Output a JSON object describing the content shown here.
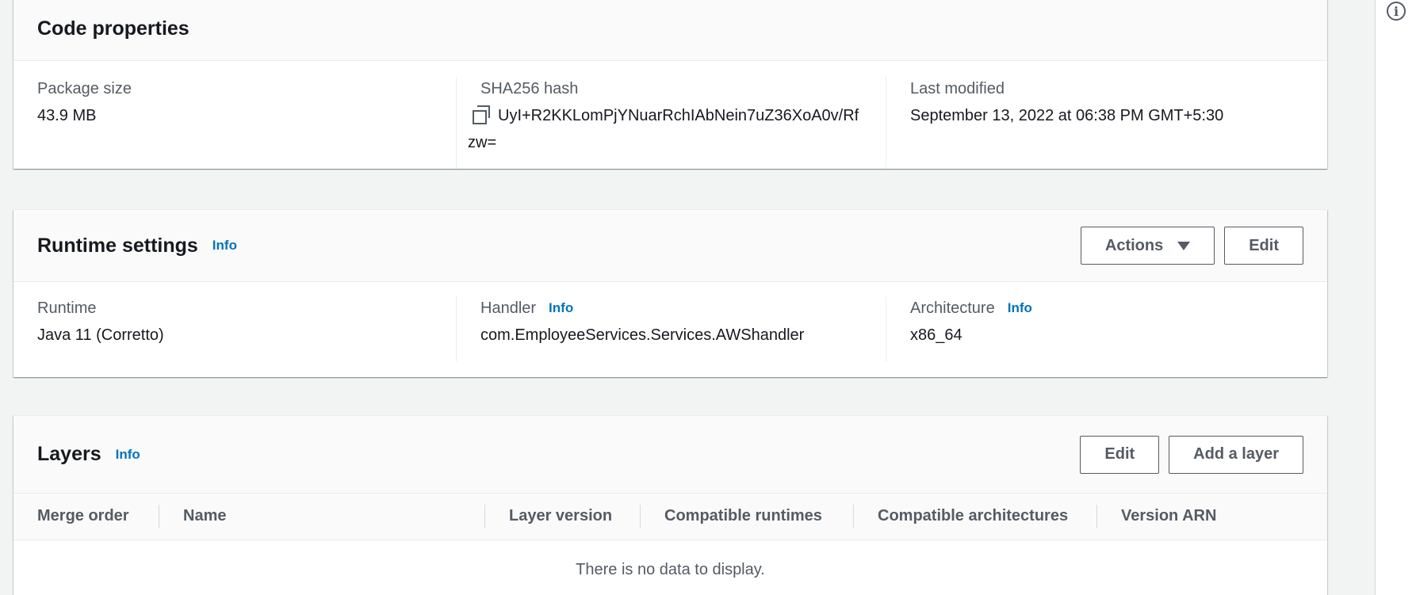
{
  "code_properties": {
    "title": "Code properties",
    "package_size": {
      "label": "Package size",
      "value": "43.9 MB"
    },
    "sha256": {
      "label": "SHA256 hash",
      "value": "UyI+R2KKLomPjYNuarRchIAbNein7uZ36XoA0v/Rfzw=",
      "icon": "copy-icon"
    },
    "last_modified": {
      "label": "Last modified",
      "value": "September 13, 2022 at 06:38 PM GMT+5:30"
    }
  },
  "runtime_settings": {
    "title": "Runtime settings",
    "info": "Info",
    "actions_label": "Actions",
    "edit_label": "Edit",
    "runtime": {
      "label": "Runtime",
      "value": "Java 11 (Corretto)"
    },
    "handler": {
      "label": "Handler",
      "info": "Info",
      "value": "com.EmployeeServices.Services.AWShandler"
    },
    "architecture": {
      "label": "Architecture",
      "info": "Info",
      "value": "x86_64"
    }
  },
  "layers": {
    "title": "Layers",
    "info": "Info",
    "edit_label": "Edit",
    "add_label": "Add a layer",
    "columns": [
      "Merge order",
      "Name",
      "Layer version",
      "Compatible runtimes",
      "Compatible architectures",
      "Version ARN"
    ],
    "empty_text": "There is no data to display."
  },
  "right_rail": {
    "icon": "info-circle-icon",
    "glyph": "i"
  },
  "colors": {
    "link": "#0073bb",
    "text": "#16191f",
    "muted": "#545b64",
    "background": "#f2f3f3"
  }
}
